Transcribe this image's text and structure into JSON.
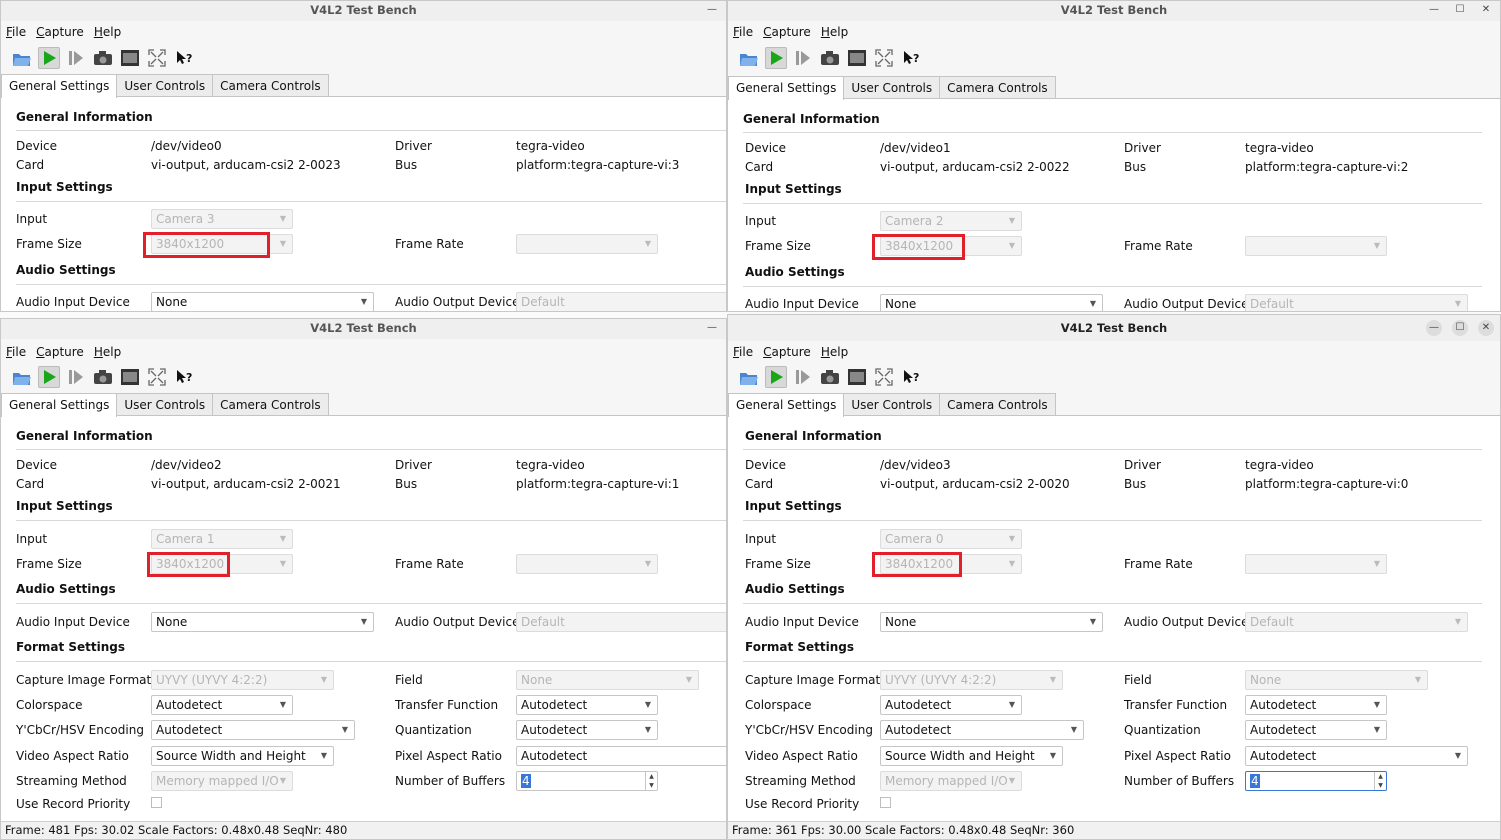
{
  "common": {
    "title": "V4L2 Test Bench",
    "menu": [
      "File",
      "Capture",
      "Help"
    ],
    "tabs": [
      "General Settings",
      "User Controls",
      "Camera Controls"
    ],
    "sections": {
      "general": "General Information",
      "input": "Input Settings",
      "audio": "Audio Settings",
      "format": "Format Settings"
    },
    "labels": {
      "device": "Device",
      "card": "Card",
      "driver": "Driver",
      "bus": "Bus",
      "input": "Input",
      "frame_size": "Frame Size",
      "frame_rate": "Frame Rate",
      "audio_input": "Audio Input Device",
      "audio_output": "Audio Output Device",
      "capture_formats": "Capture Image Formats",
      "field": "Field",
      "colorspace": "Colorspace",
      "transfer": "Transfer Function",
      "encoding": "Y'CbCr/HSV Encoding",
      "quantization": "Quantization",
      "video_aspect": "Video Aspect Ratio",
      "pixel_aspect": "Pixel Aspect Ratio",
      "streaming": "Streaming Method",
      "buffers": "Number of Buffers",
      "record_priority": "Use Record Priority"
    },
    "values": {
      "driver": "tegra-video",
      "frame_size": "3840x1200",
      "audio_input": "None",
      "audio_output": "Default",
      "capture_formats": "UYVY (UYVY 4:2:2)",
      "field": "None",
      "autodetect": "Autodetect",
      "video_aspect": "Source Width and Height",
      "streaming": "Memory mapped I/O",
      "buffers": "4"
    },
    "colors": {
      "highlight": "#e0202a",
      "accent": "#3a76d8",
      "play": "#19a619"
    },
    "window_controls": [
      "minimize-icon",
      "maximize-icon",
      "close-icon"
    ]
  },
  "windows": [
    {
      "device": "/dev/video0",
      "card": "vi-output, arducam-csi2 2-0023",
      "bus": "platform:tegra-capture-vi:3",
      "input": "Camera 3"
    },
    {
      "device": "/dev/video1",
      "card": "vi-output, arducam-csi2 2-0022",
      "bus": "platform:tegra-capture-vi:2",
      "input": "Camera 2"
    },
    {
      "device": "/dev/video2",
      "card": "vi-output, arducam-csi2 2-0021",
      "bus": "platform:tegra-capture-vi:1",
      "input": "Camera 1",
      "status": "Frame: 481 Fps: 30.02 Scale Factors: 0.48x0.48 SeqNr: 480"
    },
    {
      "device": "/dev/video3",
      "card": "vi-output, arducam-csi2 2-0020",
      "bus": "platform:tegra-capture-vi:0",
      "input": "Camera 0",
      "status": "Frame: 361 Fps: 30.00 Scale Factors: 0.48x0.48 SeqNr: 360"
    }
  ]
}
